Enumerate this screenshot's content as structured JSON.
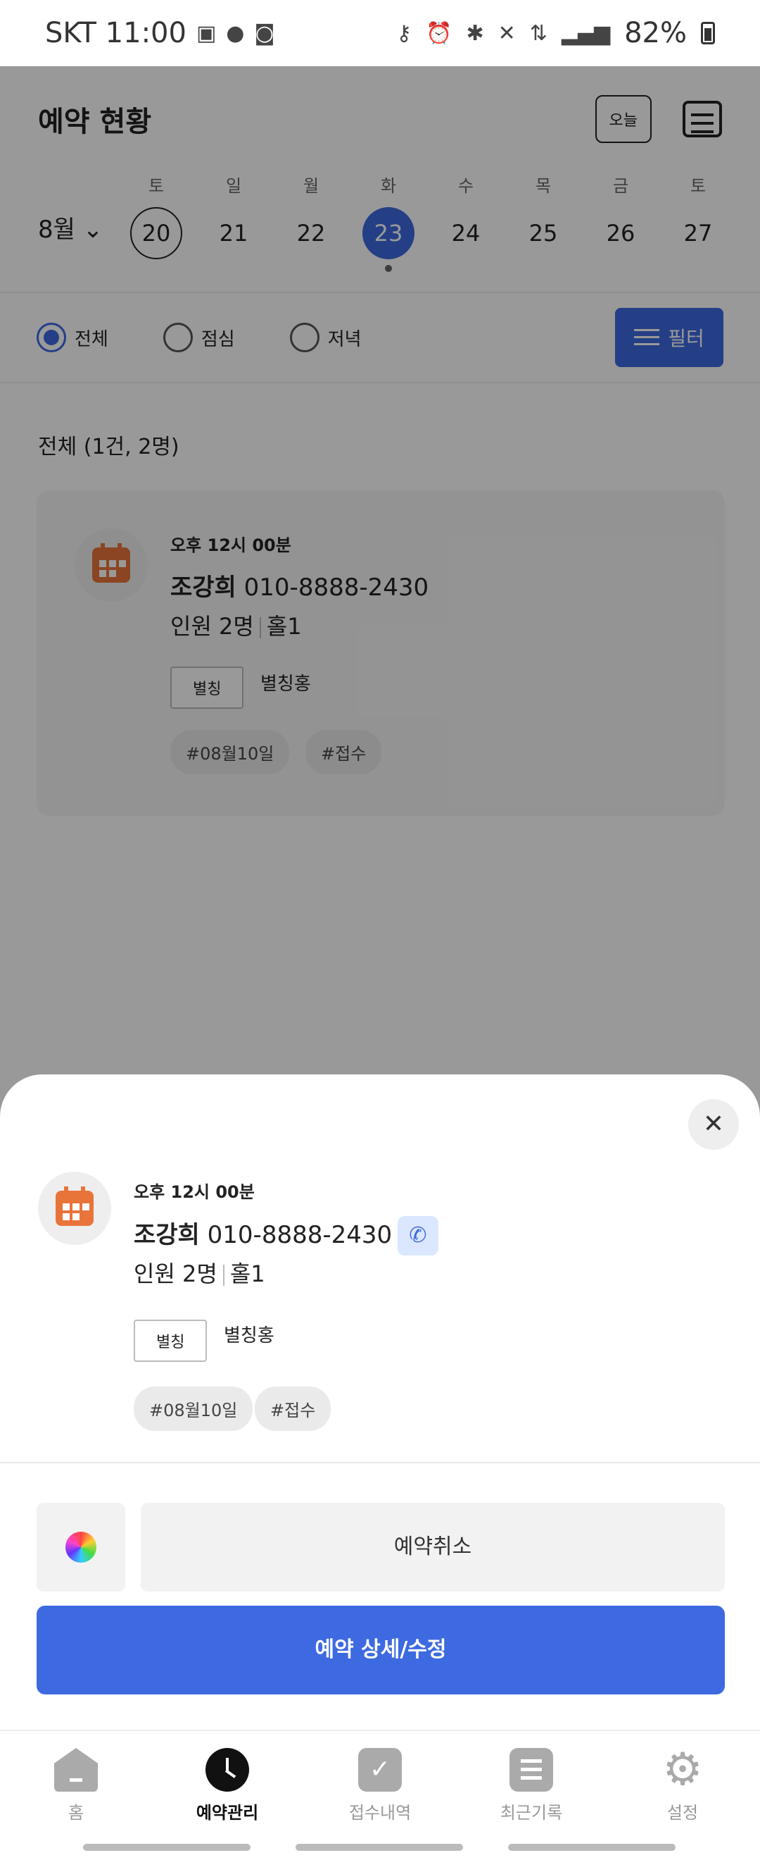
{
  "status_bar": {
    "carrier_time": "SKT 11:00",
    "battery": "82%"
  },
  "header": {
    "title": "예약 현황",
    "today_label": "오늘"
  },
  "calendar": {
    "month": "8월",
    "days": [
      {
        "dow": "토",
        "num": "20"
      },
      {
        "dow": "일",
        "num": "21"
      },
      {
        "dow": "월",
        "num": "22"
      },
      {
        "dow": "화",
        "num": "23"
      },
      {
        "dow": "수",
        "num": "24"
      },
      {
        "dow": "목",
        "num": "25"
      },
      {
        "dow": "금",
        "num": "26"
      },
      {
        "dow": "토",
        "num": "27"
      }
    ]
  },
  "filters": {
    "all": "전체",
    "lunch": "점심",
    "dinner": "저녁",
    "filter_button": "필터"
  },
  "list": {
    "count_label": "전체 (1건, 2명)"
  },
  "reservation": {
    "time": "오후 12시 00분",
    "name": "조강희",
    "phone": "010-8888-2430",
    "people": "인원 2명",
    "hall": "홀1",
    "tag_box": "별칭",
    "tag_value": "별칭홍",
    "hashtags": [
      "#08월10일",
      "#접수"
    ]
  },
  "sheet": {
    "cancel_label": "예약취소",
    "edit_label": "예약 상세/수정"
  },
  "nav": {
    "items": [
      {
        "label": "홈"
      },
      {
        "label": "예약관리"
      },
      {
        "label": "접수내역"
      },
      {
        "label": "최근기록"
      },
      {
        "label": "설정"
      }
    ]
  },
  "colors": {
    "accent": "#3d6ae0",
    "calendar_icon": "#e8743a"
  }
}
